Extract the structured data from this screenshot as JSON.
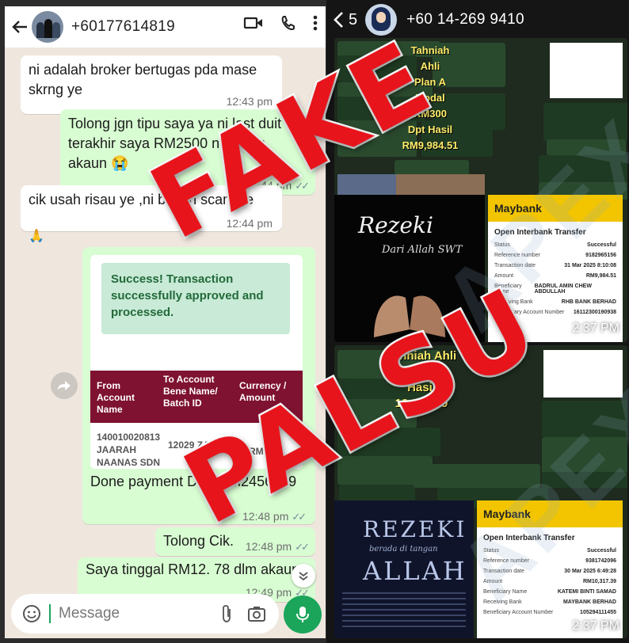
{
  "left_chat": {
    "contact_phone": "+60177614819",
    "header_icons": [
      "back-arrow-icon",
      "video-call-icon",
      "voice-call-icon",
      "more-vert-icon"
    ],
    "messages": [
      {
        "direction": "in",
        "text": "ni adalah broker bertugas pda mase skrng ye",
        "time": "12:43 pm"
      },
      {
        "direction": "out",
        "text": "Tolong jgn tipu saya ya ni last duit terakhir saya RM2500 ni dalam akaun 😭",
        "time": "12:44 pm"
      },
      {
        "direction": "in",
        "text": "cik usah risau ye ,ni bukan scam ye",
        "time": "12:44 pm"
      },
      {
        "direction": "reaction",
        "text": "🙏"
      },
      {
        "direction": "out",
        "text": "Done payment DA - RM2456. 39",
        "time": "12:48 pm"
      },
      {
        "direction": "out",
        "text": "Tolong Cik.",
        "time": "12:48 pm"
      },
      {
        "direction": "out",
        "text": "Saya tinggal RM12. 78 dlm akaun",
        "time": "12:49 pm"
      }
    ],
    "receipt_shot": {
      "success_text": "Success! Transaction successfully approved and processed.",
      "col1": "From Account Name",
      "col2": "To Account Bene Name/ Batch ID",
      "col3": "Currency / Amount",
      "cell1": "140010020813 JAARAH NAANAS SDN HD",
      "cell2": "12029 ZA",
      "cell3": "RM2,45"
    },
    "input_placeholder": "Message",
    "status_ticks": "✓✓"
  },
  "right_chat": {
    "back_count": "5",
    "contact_phone": "+60 14-269 9410",
    "image1": {
      "promo_lines": [
        "Tahniah Ahli",
        "Plan A",
        "Modal RM300",
        "Dpt Hasil",
        "RM9,984.51"
      ],
      "rezeki_title": "Rezeki",
      "rezeki_sub": "Dari Allah SWT",
      "bank": "Maybank",
      "receipt_title": "Open Interbank Transfer",
      "rows": [
        {
          "k": "Status",
          "v": "Successful"
        },
        {
          "k": "Reference number",
          "v": "9182965156"
        },
        {
          "k": "Transaction date",
          "v": "31 Mar 2025 8:10:08"
        },
        {
          "k": "Amount",
          "v": "RM9,984.51"
        },
        {
          "k": "Beneficiary Name",
          "v": "BADRUL AMIN CHEW ABDULLAH"
        },
        {
          "k": "Receiving Bank",
          "v": "RHB BANK BERHAD"
        },
        {
          "k": "Beneficiary Account Number",
          "v": "16112300190938"
        }
      ],
      "time": "2:37 PM"
    },
    "image2": {
      "promo_lines": [
        "Tahniah Ahli",
        "Plan",
        "Hasil",
        "10,317.39"
      ],
      "rezeki_title": "REZEKI",
      "rezeki_sub": "berada di tangan",
      "rezeki_big": "ALLAH",
      "bank": "Maybank",
      "receipt_title": "Open Interbank Transfer",
      "rows": [
        {
          "k": "Status",
          "v": "Successful"
        },
        {
          "k": "Reference number",
          "v": "9381742096"
        },
        {
          "k": "Transaction date",
          "v": "30 Mar 2025 6:49:28"
        },
        {
          "k": "Amount",
          "v": "RM10,317.39"
        },
        {
          "k": "Beneficiary Name",
          "v": "KATEMI BINTI SAMAD"
        },
        {
          "k": "Receiving Bank",
          "v": "MAYBANK BERHAD"
        },
        {
          "k": "Beneficiary Account Number",
          "v": "105294111455"
        }
      ],
      "time": "2:37 PM"
    }
  },
  "overlay": {
    "stamp1": "FAKE",
    "stamp2": "PALSU",
    "watermark": "APEX"
  }
}
